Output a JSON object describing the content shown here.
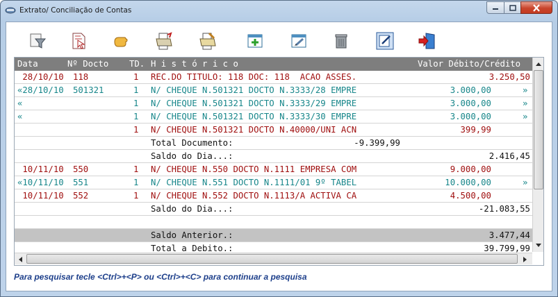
{
  "window": {
    "title": "Extrato/ Conciliação de Contas"
  },
  "toolbar": {
    "buttons": [
      {
        "name": "filter-icon"
      },
      {
        "name": "document-cursor-icon"
      },
      {
        "name": "hand-icon"
      },
      {
        "name": "print-preview-icon"
      },
      {
        "name": "print-edit-icon"
      },
      {
        "name": "add-window-icon"
      },
      {
        "name": "edit-window-icon"
      },
      {
        "name": "trash-icon"
      },
      {
        "name": "edit-note-icon"
      },
      {
        "name": "exit-door-icon"
      }
    ]
  },
  "grid": {
    "headers": {
      "date": "Data",
      "doc": "Nº Docto",
      "td": "TD.",
      "history": "H i s t ó r i c o",
      "value": "Valor Débito/Crédito"
    },
    "rows": [
      {
        "style": "red",
        "date": " 28/10/10",
        "doc": "118",
        "td": "1",
        "history": "REC.DO TITULO: 118 DOC: 118  ACAO ASSES.",
        "debit": "",
        "credit": "3.250,50",
        "mark": ""
      },
      {
        "style": "teal",
        "date": "«28/10/10",
        "doc": "501321",
        "td": "1",
        "history": "N/ CHEQUE N.501321 DOCTO N.3333/28 EMPRE",
        "debit": "3.000,00",
        "credit": "",
        "mark": "»"
      },
      {
        "style": "teal",
        "date": "«",
        "doc": "",
        "td": "1",
        "history": "N/ CHEQUE N.501321 DOCTO N.3333/29 EMPRE",
        "debit": "3.000,00",
        "credit": "",
        "mark": "»"
      },
      {
        "style": "teal",
        "date": "«",
        "doc": "",
        "td": "1",
        "history": "N/ CHEQUE N.501321 DOCTO N.3333/30 EMPRE",
        "debit": "3.000,00",
        "credit": "",
        "mark": "»"
      },
      {
        "style": "red",
        "date": "",
        "doc": "",
        "td": "1",
        "history": "N/ CHEQUE N.501321 DOCTO N.40000/UNI ACN",
        "debit": "399,99",
        "credit": "",
        "mark": ""
      },
      {
        "style": "black",
        "date": "",
        "doc": "",
        "td": "",
        "history": "Total Documento:",
        "debit": "-9.399,99",
        "credit": "",
        "mark": "",
        "debitOffset": true
      },
      {
        "style": "black",
        "date": "",
        "doc": "",
        "td": "",
        "history": "Saldo do Dia...:",
        "debit": "",
        "credit": "2.416,45",
        "mark": ""
      },
      {
        "style": "red",
        "date": " 10/11/10",
        "doc": "550",
        "td": "1",
        "history": "N/ CHEQUE N.550 DOCTO N.1111 EMPRESA COM",
        "debit": "9.000,00",
        "credit": "",
        "mark": ""
      },
      {
        "style": "teal",
        "date": "«10/11/10",
        "doc": "551",
        "td": "1",
        "history": "N/ CHEQUE N.551 DOCTO N.1111/01 9º TABEL",
        "debit": "10.000,00",
        "credit": "",
        "mark": "»"
      },
      {
        "style": "red",
        "date": " 10/11/10",
        "doc": "552",
        "td": "1",
        "history": "N/ CHEQUE N.552 DOCTO N.1113/A ACTIVA CA",
        "debit": "4.500,00",
        "credit": "",
        "mark": ""
      },
      {
        "style": "black",
        "date": "",
        "doc": "",
        "td": "",
        "history": "Saldo do Dia...:",
        "debit": "",
        "credit": "-21.083,55",
        "mark": ""
      },
      {
        "style": "black",
        "date": "",
        "doc": "",
        "td": "",
        "history": "",
        "debit": "",
        "credit": "",
        "mark": ""
      },
      {
        "style": "gray",
        "date": "",
        "doc": "",
        "td": "",
        "history": "Saldo Anterior.:",
        "debit": "",
        "credit": "3.477,44",
        "mark": ""
      },
      {
        "style": "black",
        "date": "",
        "doc": "",
        "td": "",
        "history": "Total a Debito.:",
        "debit": "",
        "credit": "39.799,99",
        "mark": ""
      }
    ]
  },
  "status": {
    "text": "Para pesquisar tecle <Ctrl>+<P>  ou <Ctrl>+<C> para continuar a pesquisa"
  }
}
